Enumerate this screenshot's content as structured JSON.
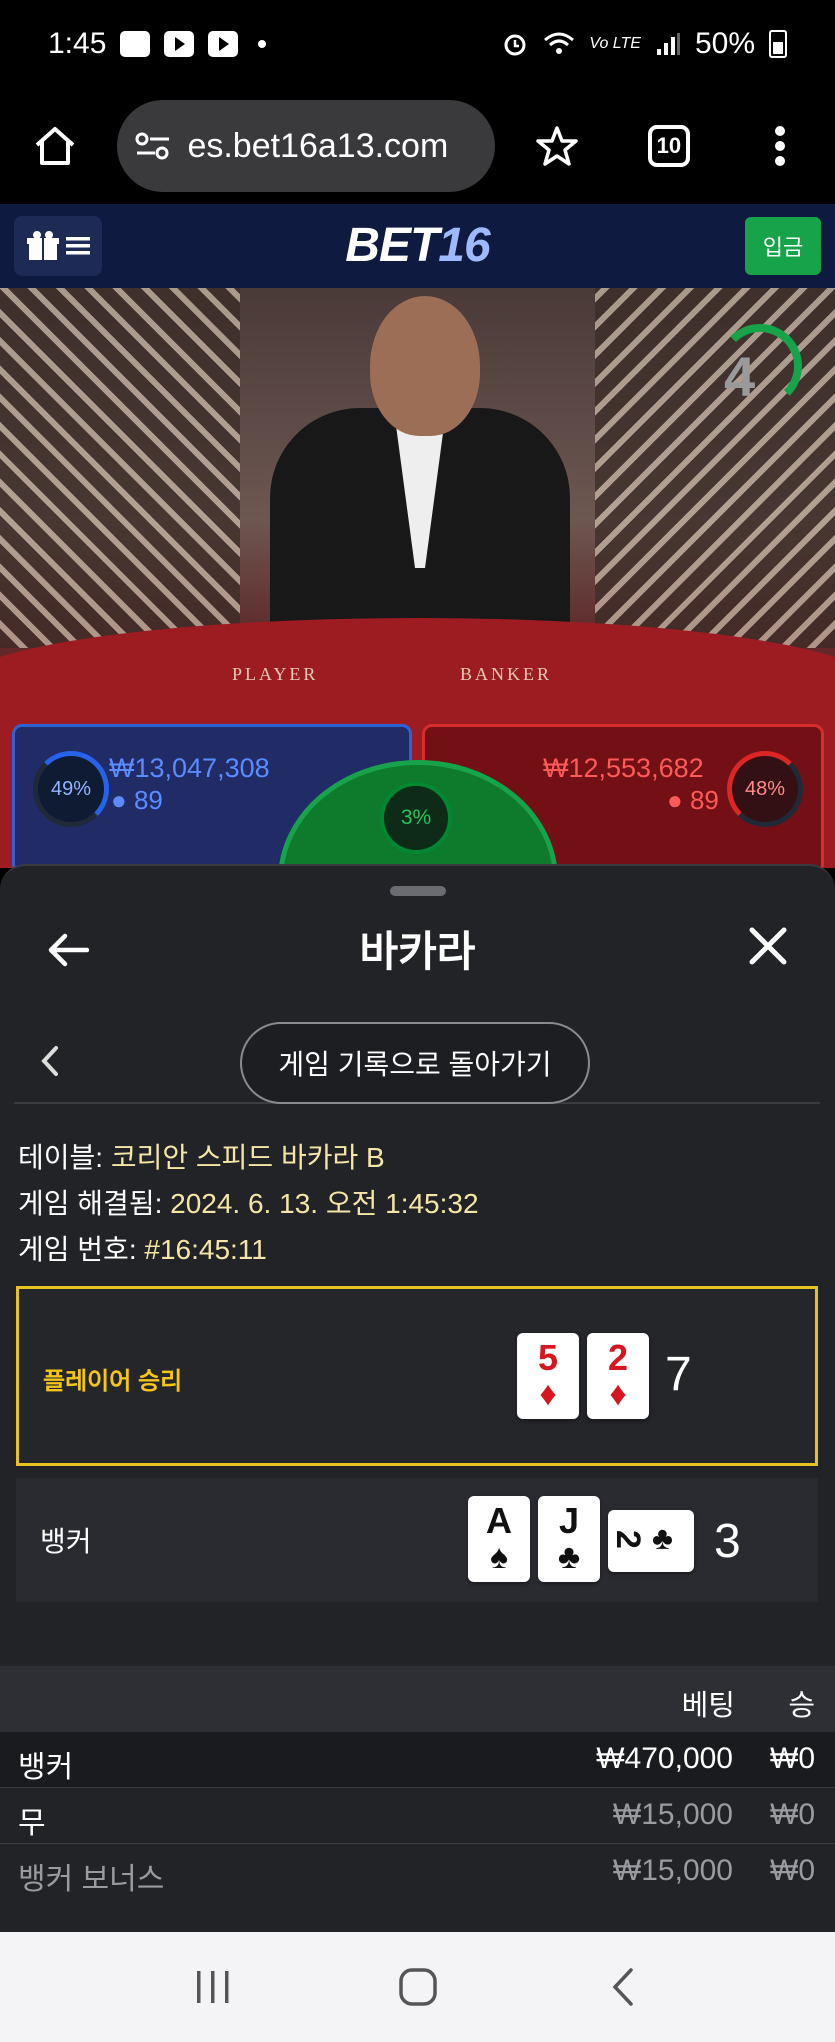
{
  "status_bar": {
    "time": "1:45",
    "battery": "50%",
    "lte": "Vo LTE"
  },
  "browser": {
    "url": "es.bet16a13.com",
    "tabs_count": "10"
  },
  "site": {
    "logo_part1": "BET",
    "logo_part2": "16",
    "deposit_label": "입금"
  },
  "video": {
    "timer": "4",
    "player_label": "PLAYER",
    "banker_label": "BANKER",
    "player_panel": {
      "percent": "49%",
      "amount": "₩13,047,308",
      "count": "89"
    },
    "banker_panel": {
      "percent": "48%",
      "amount": "₩12,553,682",
      "count": "89"
    },
    "tie_percent": "3%"
  },
  "sheet": {
    "title": "바카라",
    "history_button": "게임 기록으로 돌아가기",
    "info": {
      "table_label": "테이블: ",
      "table_value": "코리안 스피드 바카라 B",
      "resolved_label": "게임 해결됨: ",
      "resolved_value": "2024. 6. 13. 오전 1:45:32",
      "game_no_label": "게임 번호: ",
      "game_no_value": "#16:45:11"
    },
    "player_round": {
      "label": "플레이어 승리",
      "cards": [
        {
          "rank": "5",
          "suit": "♦"
        },
        {
          "rank": "2",
          "suit": "♦"
        }
      ],
      "score": "7"
    },
    "banker_round": {
      "label": "뱅커",
      "cards": [
        {
          "rank": "A",
          "suit": "♠"
        },
        {
          "rank": "J",
          "suit": "♣"
        },
        {
          "rank": "2",
          "suit": "♣"
        }
      ],
      "score": "3"
    },
    "bets_table": {
      "headers": {
        "bet": "베팅",
        "win": "승"
      },
      "rows": [
        {
          "name": "뱅커",
          "bet": "₩470,000",
          "win": "₩0"
        },
        {
          "name": "무",
          "bet": "₩15,000",
          "win": "₩0"
        },
        {
          "name": "뱅커 보너스",
          "bet": "₩15,000",
          "win": "₩0"
        }
      ]
    }
  },
  "colors": {
    "accent_green": "#16a34a",
    "winner_gold": "#e8c21e",
    "player_blue": "#2563eb",
    "banker_red": "#dc2626"
  }
}
